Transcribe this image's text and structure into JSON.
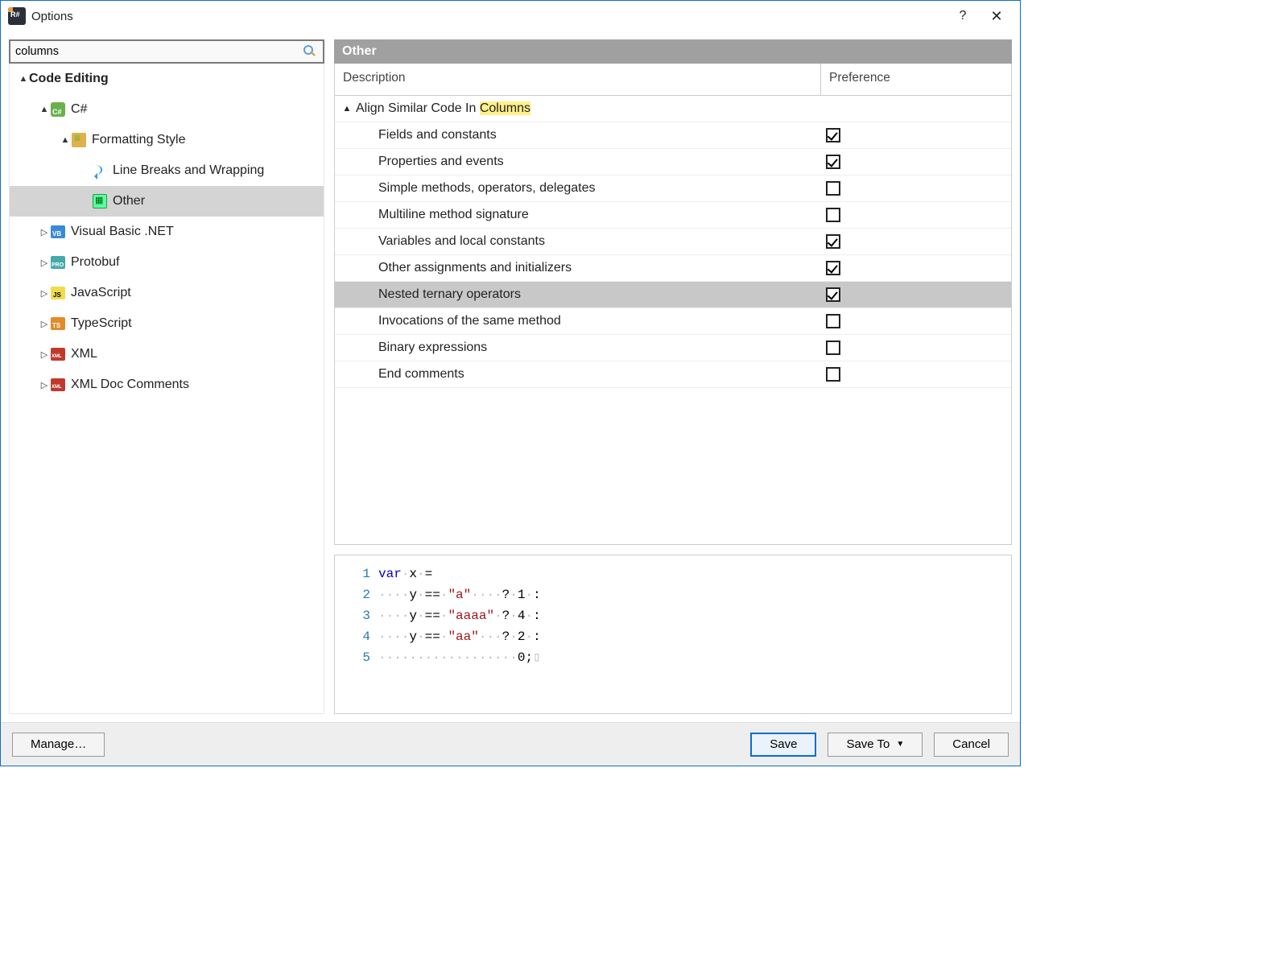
{
  "window": {
    "title": "Options"
  },
  "search": {
    "value": "columns"
  },
  "tree": {
    "root": {
      "label": "Code Editing"
    },
    "csharp": {
      "label": "C#"
    },
    "formatting": {
      "label": "Formatting Style"
    },
    "linebreaks": {
      "label": "Line Breaks and Wrapping"
    },
    "other": {
      "label": "Other"
    },
    "vb": {
      "label": "Visual Basic .NET"
    },
    "protobuf": {
      "label": "Protobuf"
    },
    "js": {
      "label": "JavaScript"
    },
    "ts": {
      "label": "TypeScript"
    },
    "xml": {
      "label": "XML"
    },
    "xmldoc": {
      "label": "XML Doc Comments"
    }
  },
  "section": {
    "title": "Other"
  },
  "grid": {
    "head": {
      "col1": "Description",
      "col2": "Preference"
    },
    "group": {
      "prefix": "Align Similar Code In ",
      "highlight": "Columns"
    },
    "rows": [
      {
        "label": "Fields and constants",
        "checked": true
      },
      {
        "label": "Properties and events",
        "checked": true
      },
      {
        "label": "Simple methods, operators, delegates",
        "checked": false
      },
      {
        "label": "Multiline method signature",
        "checked": false
      },
      {
        "label": "Variables and local constants",
        "checked": true
      },
      {
        "label": "Other assignments and initializers",
        "checked": true
      },
      {
        "label": "Nested ternary operators",
        "checked": true,
        "selected": true
      },
      {
        "label": "Invocations of the same method",
        "checked": false
      },
      {
        "label": "Binary expressions",
        "checked": false
      },
      {
        "label": "End comments",
        "checked": false
      }
    ]
  },
  "code": {
    "lines": [
      {
        "n": "1",
        "tokens": [
          [
            "kw",
            "var"
          ],
          [
            "dot",
            "·"
          ],
          [
            "op",
            "x"
          ],
          [
            "dot",
            "·"
          ],
          [
            "op",
            "="
          ]
        ]
      },
      {
        "n": "2",
        "tokens": [
          [
            "dot",
            "····"
          ],
          [
            "op",
            "y"
          ],
          [
            "dot",
            "·"
          ],
          [
            "op",
            "=="
          ],
          [
            "dot",
            "·"
          ],
          [
            "str",
            "\"a\""
          ],
          [
            "dot",
            "····"
          ],
          [
            "op",
            "?"
          ],
          [
            "dot",
            "·"
          ],
          [
            "num",
            "1"
          ],
          [
            "dot",
            "·"
          ],
          [
            "op",
            ":"
          ]
        ]
      },
      {
        "n": "3",
        "tokens": [
          [
            "dot",
            "····"
          ],
          [
            "op",
            "y"
          ],
          [
            "dot",
            "·"
          ],
          [
            "op",
            "=="
          ],
          [
            "dot",
            "·"
          ],
          [
            "str",
            "\"aaaa\""
          ],
          [
            "dot",
            "·"
          ],
          [
            "op",
            "?"
          ],
          [
            "dot",
            "·"
          ],
          [
            "num",
            "4"
          ],
          [
            "dot",
            "·"
          ],
          [
            "op",
            ":"
          ]
        ]
      },
      {
        "n": "4",
        "tokens": [
          [
            "dot",
            "····"
          ],
          [
            "op",
            "y"
          ],
          [
            "dot",
            "·"
          ],
          [
            "op",
            "=="
          ],
          [
            "dot",
            "·"
          ],
          [
            "str",
            "\"aa\""
          ],
          [
            "dot",
            "···"
          ],
          [
            "op",
            "?"
          ],
          [
            "dot",
            "·"
          ],
          [
            "num",
            "2"
          ],
          [
            "dot",
            "·"
          ],
          [
            "op",
            ":"
          ]
        ]
      },
      {
        "n": "5",
        "tokens": [
          [
            "dot",
            "··················"
          ],
          [
            "num",
            "0"
          ],
          [
            "op",
            ";"
          ],
          [
            "eol",
            "▯"
          ]
        ]
      }
    ]
  },
  "footer": {
    "manage": "Manage…",
    "save": "Save",
    "saveto": "Save To",
    "cancel": "Cancel"
  }
}
